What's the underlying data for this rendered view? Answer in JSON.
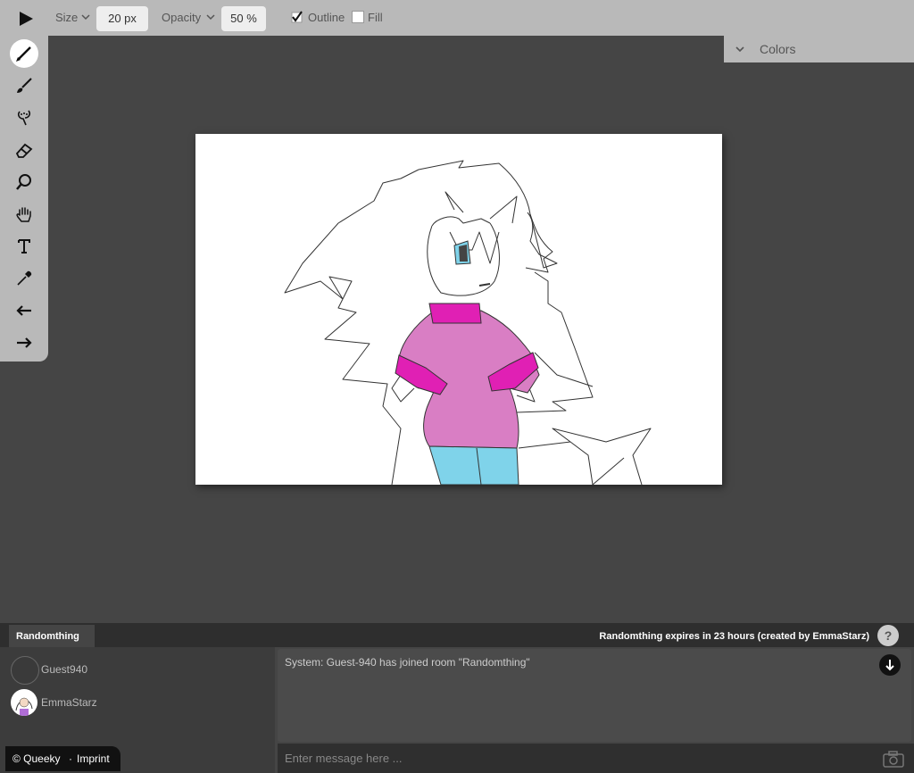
{
  "toolbar": {
    "play_icon": "play-icon",
    "size_label": "Size",
    "size_value": "20 px",
    "opacity_label": "Opacity",
    "opacity_value": "50 %",
    "outline_label": "Outline",
    "outline_checked": true,
    "fill_label": "Fill",
    "fill_checked": false
  },
  "tools": [
    "pen-icon",
    "brush-icon",
    "airbrush-icon",
    "eraser-icon",
    "zoom-icon",
    "hand-icon",
    "text-icon",
    "eyedropper-icon",
    "undo-icon",
    "redo-icon"
  ],
  "colors_panel": {
    "label": "Colors"
  },
  "room": {
    "tab_name": "Randomthing",
    "expires_text": "Randomthing expires in 23 hours (created by EmmaStarz)",
    "help_label": "?"
  },
  "users": [
    {
      "name": "Guest940"
    },
    {
      "name": "EmmaStarz"
    }
  ],
  "chat": {
    "system_message": "System:  Guest-940 has joined room \"Randomthing\"",
    "input_placeholder": "Enter message here ..."
  },
  "footer": {
    "copyright": "© Queeky",
    "separator": "·",
    "imprint": "Imprint"
  },
  "palette": {
    "toolbar_bg": "#b9b9b9",
    "workspace_bg": "#454545",
    "sweater": "#d97ec4",
    "cuffs": "#e020b4",
    "jeans": "#7fd3ea"
  }
}
